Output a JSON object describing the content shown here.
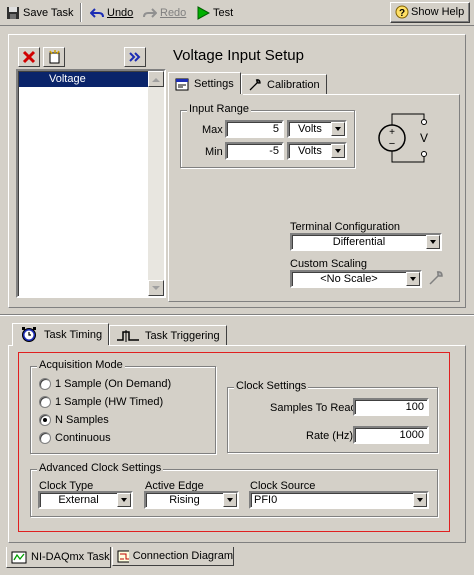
{
  "toolbar": {
    "save_task": "Save Task",
    "undo": "Undo",
    "redo": "Redo",
    "test": "Test",
    "show_help": "Show Help"
  },
  "channel_list": {
    "items": [
      "Voltage"
    ]
  },
  "setup": {
    "title": "Voltage Input Setup",
    "tabs": [
      "Settings",
      "Calibration"
    ],
    "input_range": {
      "title": "Input Range",
      "max_label": "Max",
      "max_value": "5",
      "max_unit": "Volts",
      "min_label": "Min",
      "min_value": "-5",
      "min_unit": "Volts"
    },
    "terminal_config": {
      "label": "Terminal Configuration",
      "value": "Differential"
    },
    "custom_scaling": {
      "label": "Custom Scaling",
      "value": "<No Scale>"
    }
  },
  "timing": {
    "tabs": [
      "Task Timing",
      "Task Triggering"
    ],
    "acquisition_mode": {
      "title": "Acquisition Mode",
      "options": [
        "1 Sample (On Demand)",
        "1 Sample (HW Timed)",
        "N Samples",
        "Continuous"
      ],
      "selected": "N Samples"
    },
    "clock_settings": {
      "title": "Clock Settings",
      "samples_label": "Samples To Read",
      "samples_value": "100",
      "rate_label": "Rate (Hz)",
      "rate_value": "1000"
    },
    "advanced_clock": {
      "title": "Advanced Clock Settings",
      "clock_type_label": "Clock Type",
      "clock_type_value": "External",
      "active_edge_label": "Active Edge",
      "active_edge_value": "Rising",
      "clock_source_label": "Clock Source",
      "clock_source_value": "PFI0"
    }
  },
  "bottom_tabs": [
    "NI-DAQmx Task",
    "Connection Diagram"
  ],
  "colors": {
    "face": "#d4d0c8",
    "selection": "#0a246a",
    "highlight_border": "#e02020",
    "test_green": "#00b000",
    "remove_red": "#d00000",
    "expand_blue": "#1c2cb4"
  }
}
